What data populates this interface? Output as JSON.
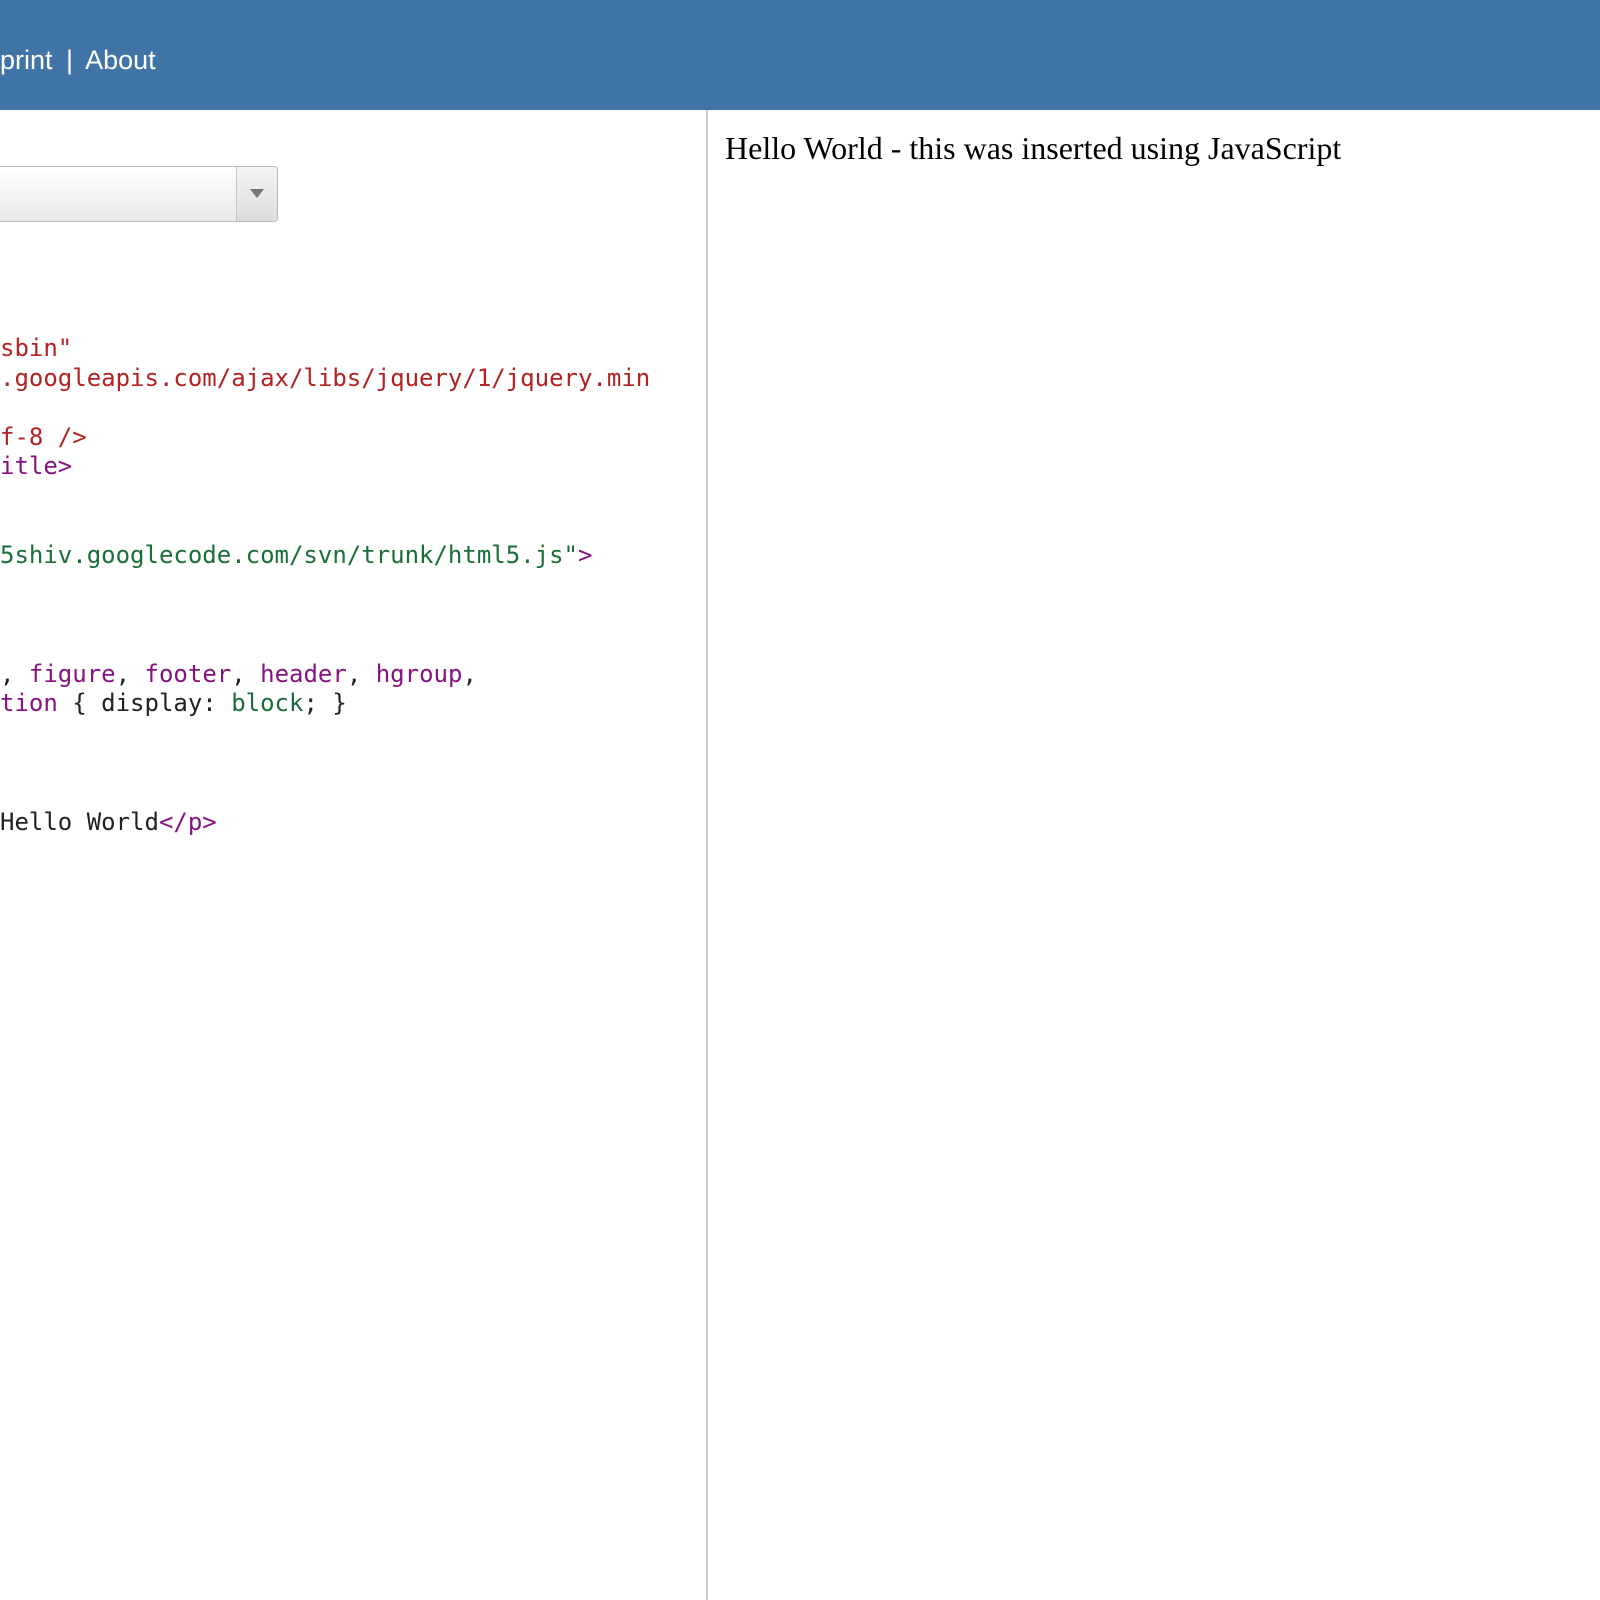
{
  "topbar": {
    "nav_print": "print",
    "nav_separator": "|",
    "nav_about": "About"
  },
  "editor": {
    "dropdown_value": "",
    "code_lines": [
      [
        {
          "t": "sbin\"",
          "c": "str"
        }
      ],
      [
        {
          "t": ".googleapis.com/ajax/libs/jquery/1/jquery.min",
          "c": "str"
        }
      ],
      [],
      [
        {
          "t": "f-8 />",
          "c": "str"
        }
      ],
      [
        {
          "t": "itle>",
          "c": "tag"
        }
      ],
      [],
      [],
      [
        {
          "t": "5shiv.googlecode.com/svn/trunk/html5.js\"",
          "c": "attr"
        },
        {
          "t": ">",
          "c": "tag"
        }
      ],
      [],
      [],
      [],
      [
        {
          "t": ", ",
          "c": "plain"
        },
        {
          "t": "figure",
          "c": "kw"
        },
        {
          "t": ", ",
          "c": "plain"
        },
        {
          "t": "footer",
          "c": "kw"
        },
        {
          "t": ", ",
          "c": "plain"
        },
        {
          "t": "header",
          "c": "kw"
        },
        {
          "t": ", ",
          "c": "plain"
        },
        {
          "t": "hgroup",
          "c": "kw"
        },
        {
          "t": ",",
          "c": "plain"
        }
      ],
      [
        {
          "t": "tion",
          "c": "kw"
        },
        {
          "t": " { display: ",
          "c": "plain"
        },
        {
          "t": "block",
          "c": "val"
        },
        {
          "t": "; }",
          "c": "plain"
        }
      ],
      [],
      [],
      [],
      [
        {
          "t": "Hello World",
          "c": "plain"
        },
        {
          "t": "</p>",
          "c": "tag"
        }
      ]
    ]
  },
  "output": {
    "text": "Hello World - this was inserted using JavaScript"
  },
  "colors": {
    "topbar": "#4174a6",
    "divider": "#cfcfcf"
  },
  "icons": {
    "dropdown": "chevron-down-icon"
  }
}
